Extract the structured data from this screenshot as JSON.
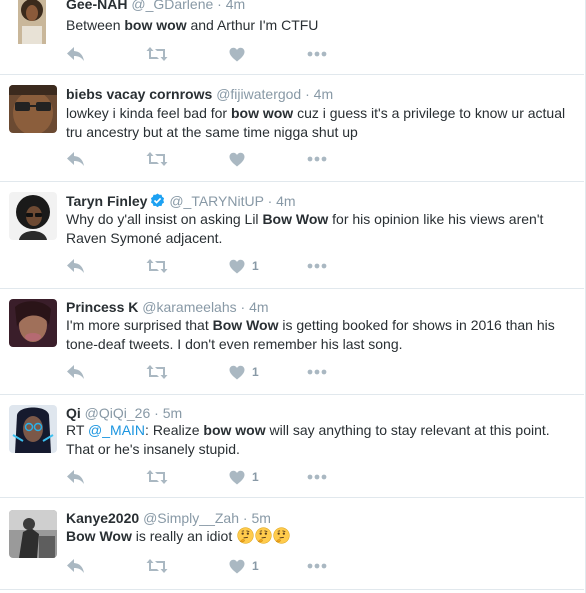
{
  "tweets": [
    {
      "fullname": "Gee-NAH",
      "username": "@_GDarlene",
      "dot": "·",
      "time": "4m",
      "text": [
        {
          "t": "Between "
        },
        {
          "t": "bow wow",
          "b": true
        },
        {
          "t": " and Arthur I'm CTFU"
        }
      ],
      "likes": ""
    },
    {
      "fullname": "biebs vacay cornrows",
      "username": "@fijiwatergod",
      "dot": "·",
      "time": "4m",
      "text": [
        {
          "t": "lowkey i kinda feel bad for "
        },
        {
          "t": "bow wow",
          "b": true
        },
        {
          "t": " cuz i guess it's a privilege to know ur actual tru ancestry but at the same time nigga shut up"
        }
      ],
      "likes": ""
    },
    {
      "fullname": "Taryn Finley",
      "username": "@_TARYNitUP",
      "dot": "·",
      "time": "4m",
      "verified": true,
      "text": [
        {
          "t": "Why do y'all insist on asking Lil "
        },
        {
          "t": "Bow Wow",
          "b": true
        },
        {
          "t": " for his opinion like his views aren't Raven Symoné adjacent."
        }
      ],
      "likes": "1"
    },
    {
      "fullname": "Princess K",
      "username": "@karameelahs",
      "dot": "·",
      "time": "4m",
      "text": [
        {
          "t": "I'm more surprised that "
        },
        {
          "t": "Bow Wow",
          "b": true
        },
        {
          "t": " is getting booked for shows in 2016 than his tone-deaf tweets. I don't even remember his last song."
        }
      ],
      "likes": "1"
    },
    {
      "fullname": "Qi",
      "username": "@QiQi_26",
      "dot": "·",
      "time": "5m",
      "text": [
        {
          "t": "RT "
        },
        {
          "t": "@_MAIN",
          "m": true
        },
        {
          "t": ": Realize "
        },
        {
          "t": "bow wow",
          "b": true
        },
        {
          "t": " will say anything to stay relevant at this point. That or he's insanely stupid."
        }
      ],
      "likes": "1"
    },
    {
      "fullname": "Kanye2020",
      "username": "@Simply__Zah",
      "dot": "·",
      "time": "5m",
      "emoji_count": 3,
      "text": [
        {
          "t": "Bow Wow",
          "b": true
        },
        {
          "t": " is really an idiot "
        }
      ],
      "likes": "1"
    }
  ],
  "icons": {
    "reply": "reply-icon",
    "retweet": "retweet-icon",
    "like": "heart-icon",
    "more": "more-dots-icon",
    "verified": "verified-badge-icon",
    "emoji": "thinking-face-emoji"
  },
  "colors": {
    "icon_gray": "#aab8c2",
    "meta_gray": "#8899a6",
    "text": "#292f33",
    "link_blue": "#1b95e0",
    "verified_blue": "#1da1f2",
    "divider": "#e1e8ed"
  }
}
